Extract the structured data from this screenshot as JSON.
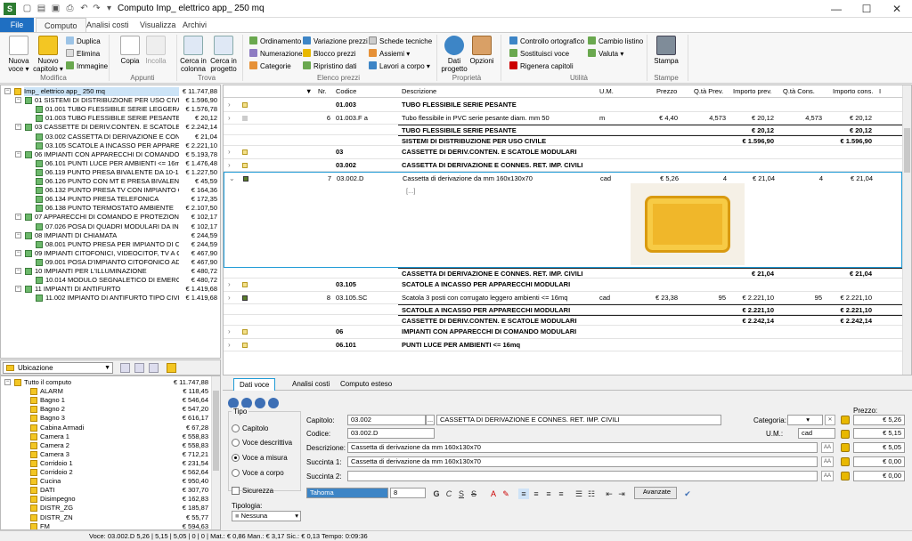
{
  "window": {
    "title": "Computo Imp_ elettrico app_ 250 mq",
    "app_icon": "S",
    "controls": [
      "—",
      "☐",
      "✕"
    ]
  },
  "ribbon_tabs": [
    "File",
    "Computo",
    "Analisi costi",
    "Visualizza",
    "Archivi"
  ],
  "ribbon": {
    "modifica": {
      "group": "Modifica",
      "nuova_voce": "Nuova voce ▾",
      "nuovo_capitolo": "Nuovo capitolo ▾",
      "duplica": "Duplica",
      "elimina": "Elimina",
      "immagine": "Immagine"
    },
    "appunti": {
      "group": "Appunti",
      "copia": "Copia",
      "incolla": "Incolla"
    },
    "trova": {
      "group": "Trova",
      "cerca_colonna": "Cerca in colonna",
      "cerca_progetto": "Cerca in progetto"
    },
    "elenco": {
      "group": "Elenco prezzi",
      "ordinamento": "Ordinamento",
      "numerazione": "Numerazione",
      "categorie": "Categorie",
      "variazione": "Variazione prezzi",
      "blocco": "Blocco prezzi",
      "ripristino": "Ripristino dati",
      "schede": "Schede tecniche",
      "assiemi": "Assiemi ▾",
      "lavori": "Lavori a corpo ▾"
    },
    "proprieta": {
      "group": "Proprietà",
      "dati": "Dati progetto",
      "opzioni": "Opzioni"
    },
    "utilita": {
      "group": "Utilità",
      "controllo": "Controllo ortografico",
      "sostituisci": "Sostituisci voce",
      "rigenera": "Rigenera capitoli",
      "cambio": "Cambio listino",
      "valuta": "Valuta ▾"
    },
    "stampe": {
      "group": "Stampe",
      "stampa": "Stampa"
    }
  },
  "tree": [
    {
      "level": 0,
      "type": "folder",
      "label": "Imp_ elettrico app_ 250 mq",
      "value": "€ 11.747,88",
      "selected": true
    },
    {
      "level": 1,
      "type": "doc",
      "label": "01  SISTEMI DI DISTRIBUZIONE PER USO CIVILE",
      "value": "€ 1.596,90"
    },
    {
      "level": 2,
      "type": "doc",
      "label": "01.001  TUBO FLESSIBILE SERIE LEGGERA",
      "value": "€ 1.576,78"
    },
    {
      "level": 2,
      "type": "doc",
      "label": "01.003  TUBO FLESSIBILE SERIE PESANTE",
      "value": "€ 20,12"
    },
    {
      "level": 1,
      "type": "doc",
      "label": "03  CASSETTE DI DERIV.CONTEN. E SCATOLE MOD...",
      "value": "€ 2.242,14"
    },
    {
      "level": 2,
      "type": "doc",
      "label": "03.002  CASSETTA DI DERIVAZIONE E CONNES...",
      "value": "€ 21,04"
    },
    {
      "level": 2,
      "type": "doc",
      "label": "03.105  SCATOLE A INCASSO PER APPARECCH...",
      "value": "€ 2.221,10"
    },
    {
      "level": 1,
      "type": "doc",
      "label": "06  IMPIANTI CON APPARECCHI DI COMANDO MOD...",
      "value": "€ 5.193,78"
    },
    {
      "level": 2,
      "type": "doc",
      "label": "06.101  PUNTI LUCE PER AMBIENTI <= 16mq",
      "value": "€ 1.476,48"
    },
    {
      "level": 2,
      "type": "doc",
      "label": "06.119  PUNTO PRESA BIVALENTE DA 10-16 A",
      "value": "€ 1.227,50"
    },
    {
      "level": 2,
      "type": "doc",
      "label": "06.126  PUNTO CON MT E PRESA BIVALENTE D...",
      "value": "€ 45,59"
    },
    {
      "level": 2,
      "type": "doc",
      "label": "06.132  PUNTO PRESA TV CON IMPIANTO COAX...",
      "value": "€ 164,36"
    },
    {
      "level": 2,
      "type": "doc",
      "label": "06.134  PUNTO PRESA TELEFONICA",
      "value": "€ 172,35"
    },
    {
      "level": 2,
      "type": "doc",
      "label": "06.138  PUNTO TERMOSTATO AMBIENTE",
      "value": "€ 2.107,50"
    },
    {
      "level": 1,
      "type": "doc",
      "label": "07  APPARECCHI DI COMANDO E PROTEZIONE",
      "value": "€ 102,17"
    },
    {
      "level": 2,
      "type": "doc",
      "label": "07.026  POSA DI QUADRI MODULARI DA INCA...",
      "value": "€ 102,17"
    },
    {
      "level": 1,
      "type": "doc",
      "label": "08  IMPIANTI DI CHIAMATA",
      "value": "€ 244,59"
    },
    {
      "level": 2,
      "type": "doc",
      "label": "08.001  PUNTO PRESA PER IMPIANTO DI CHIA...",
      "value": "€ 244,59"
    },
    {
      "level": 1,
      "type": "doc",
      "label": "09  IMPIANTI CITOFONICI, VIDEOCITOF, TV A CIR...",
      "value": "€ 467,90"
    },
    {
      "level": 2,
      "type": "doc",
      "label": "09.001  POSA D'IMPIANTO CITOFONICO AD 1 ...",
      "value": "€ 467,90"
    },
    {
      "level": 1,
      "type": "doc",
      "label": "10  IMPIANTI PER L'ILLUMINAZIONE",
      "value": "€ 480,72"
    },
    {
      "level": 2,
      "type": "doc",
      "label": "10.014  MODULO SEGNALETICO DI EMERGENZA",
      "value": "€ 480,72"
    },
    {
      "level": 1,
      "type": "doc",
      "label": "11  IMPIANTI DI ANTIFURTO",
      "value": "€ 1.419,68"
    },
    {
      "level": 2,
      "type": "doc",
      "label": "11.002  IMPIANTO DI ANTIFURTO TIPO CIVILE ...",
      "value": "€ 1.419,68"
    }
  ],
  "ubicazione": {
    "combo": "Ubicazione",
    "items": [
      {
        "level": 0,
        "label": "Tutto il computo",
        "value": "€ 11.747,88"
      },
      {
        "level": 1,
        "label": "ALARM",
        "value": "€ 118,45"
      },
      {
        "level": 1,
        "label": "Bagno 1",
        "value": "€ 546,64"
      },
      {
        "level": 1,
        "label": "Bagno 2",
        "value": "€ 547,20"
      },
      {
        "level": 1,
        "label": "Bagno 3",
        "value": "€ 616,17"
      },
      {
        "level": 1,
        "label": "Cabina Armadi",
        "value": "€ 67,28"
      },
      {
        "level": 1,
        "label": "Camera 1",
        "value": "€ 558,83"
      },
      {
        "level": 1,
        "label": "Camera 2",
        "value": "€ 558,83"
      },
      {
        "level": 1,
        "label": "Camera 3",
        "value": "€ 712,21"
      },
      {
        "level": 1,
        "label": "Corridoio 1",
        "value": "€ 231,54"
      },
      {
        "level": 1,
        "label": "Corridoio 2",
        "value": "€ 562,64"
      },
      {
        "level": 1,
        "label": "Cucina",
        "value": "€ 950,40"
      },
      {
        "level": 1,
        "label": "DATI",
        "value": "€ 307,70"
      },
      {
        "level": 1,
        "label": "Disimpegno",
        "value": "€ 162,83"
      },
      {
        "level": 1,
        "label": "DISTR_ZG",
        "value": "€ 185,87"
      },
      {
        "level": 1,
        "label": "DISTR_ZN",
        "value": "€ 55,77"
      },
      {
        "level": 1,
        "label": "FM",
        "value": "€ 594,63"
      }
    ]
  },
  "grid": {
    "headers": {
      "nr": "Nr.",
      "codice": "Codice",
      "descrizione": "Descrizione",
      "um": "U.M.",
      "prezzo": "Prezzo",
      "qta_prev": "Q.tà Prev.",
      "importo_prev": "Importo prev.",
      "qta_cons": "Q.tà Cons.",
      "importo_cons": "Importo cons.",
      "i": "I"
    },
    "rows": [
      {
        "kind": "chapter",
        "codice": "01.003",
        "descrizione": "TUBO FLESSIBILE SERIE PESANTE"
      },
      {
        "kind": "item",
        "nr": "6",
        "codice": "01.003.F a",
        "descrizione": "Tubo flessibile in PVC serie pesante diam. mm 50",
        "um": "m",
        "prezzo": "€ 4,40",
        "qta_prev": "4,573",
        "importo_prev": "€ 20,12",
        "qta_cons": "4,573",
        "importo_cons": "€ 20,12"
      },
      {
        "kind": "total",
        "descrizione": "TUBO FLESSIBILE SERIE PESANTE",
        "importo_prev": "€ 20,12",
        "importo_cons": "€ 20,12"
      },
      {
        "kind": "total",
        "descrizione": "SISTEMI DI DISTRIBUZIONE PER USO CIVILE",
        "importo_prev": "€ 1.596,90",
        "importo_cons": "€ 1.596,90"
      },
      {
        "kind": "chapter",
        "codice": "03",
        "descrizione": "CASSETTE DI DERIV.CONTEN. E SCATOLE MODULARI"
      },
      {
        "kind": "chapter",
        "codice": "03.002",
        "descrizione": "CASSETTA DI DERIVAZIONE E CONNES. RET. IMP. CIVILI"
      },
      {
        "kind": "selected",
        "nr": "7",
        "codice": "03.002.D",
        "descrizione": "Cassetta di derivazione da mm 160x130x70",
        "more": "[...]",
        "um": "cad",
        "prezzo": "€ 5,26",
        "qta_prev": "4",
        "importo_prev": "€ 21,04",
        "qta_cons": "4",
        "importo_cons": "€ 21,04"
      },
      {
        "kind": "total",
        "descrizione": "CASSETTA DI DERIVAZIONE E CONNES. RET. IMP. CIVILI",
        "importo_prev": "€ 21,04",
        "importo_cons": "€ 21,04"
      },
      {
        "kind": "chapter",
        "codice": "03.105",
        "descrizione": "SCATOLE A INCASSO PER APPARECCHI MODULARI"
      },
      {
        "kind": "item",
        "nr": "8",
        "codice": "03.105.SC",
        "descrizione": "Scatola 3 posti con corrugato leggero ambienti <= 16mq",
        "um": "cad",
        "prezzo": "€ 23,38",
        "qta_prev": "95",
        "importo_prev": "€ 2.221,10",
        "qta_cons": "95",
        "importo_cons": "€ 2.221,10"
      },
      {
        "kind": "total",
        "descrizione": "SCATOLE A INCASSO PER APPARECCHI MODULARI",
        "importo_prev": "€ 2.221,10",
        "importo_cons": "€ 2.221,10"
      },
      {
        "kind": "total",
        "descrizione": "CASSETTE DI DERIV.CONTEN. E SCATOLE MODULARI",
        "importo_prev": "€ 2.242,14",
        "importo_cons": "€ 2.242,14"
      },
      {
        "kind": "chapter",
        "codice": "06",
        "descrizione": "IMPIANTI CON APPARECCHI DI COMANDO MODULARI"
      },
      {
        "kind": "chapter",
        "codice": "06.101",
        "descrizione": "PUNTI LUCE PER AMBIENTI <= 16mq"
      }
    ]
  },
  "detail_tabs": [
    "Dati voce",
    "Analisi costi",
    "Computo esteso"
  ],
  "detail": {
    "tipo_label": "Tipo",
    "tipo_options": [
      "Capitolo",
      "Voce descrittiva",
      "Voce a misura",
      "Voce a corpo"
    ],
    "sicurezza": "Sicurezza",
    "tipologia_label": "Tipologia:",
    "tipologia_value": "Nessuna",
    "capitolo_label": "Capitolo:",
    "capitolo_code": "03.002",
    "capitolo_dots": "...",
    "capitolo_desc": "CASSETTA DI DERIVAZIONE E CONNES. RET. IMP. CIVILI",
    "codice_label": "Codice:",
    "codice_value": "03.002.D",
    "descrizione_label": "Descrizione:",
    "descrizione_value": "Cassetta di derivazione da mm 160x130x70",
    "succinta1_label": "Succinta 1:",
    "succinta1_value": "Cassetta di derivazione da mm 160x130x70",
    "succinta2_label": "Succinta 2:",
    "succinta2_value": "",
    "categoria_label": "Categoria:",
    "um_label": "U.M.:",
    "um_value": "cad",
    "prezzo_label": "Prezzo:",
    "prezzi": [
      "€ 5,26",
      "€ 5,15",
      "€ 5,05",
      "€ 0,00",
      "€ 0,00"
    ],
    "font_name": "Tahoma",
    "font_size": "8",
    "avanzate": "Avanzate",
    "aa": "AA"
  },
  "status": "Voce: 03.002.D   5,26 | 5,15 | 5,05 | 0 | 0 |   Mat.: € 0,86   Man.: € 3,17   Sic.: € 0,13   Tempo: 0:09:36"
}
